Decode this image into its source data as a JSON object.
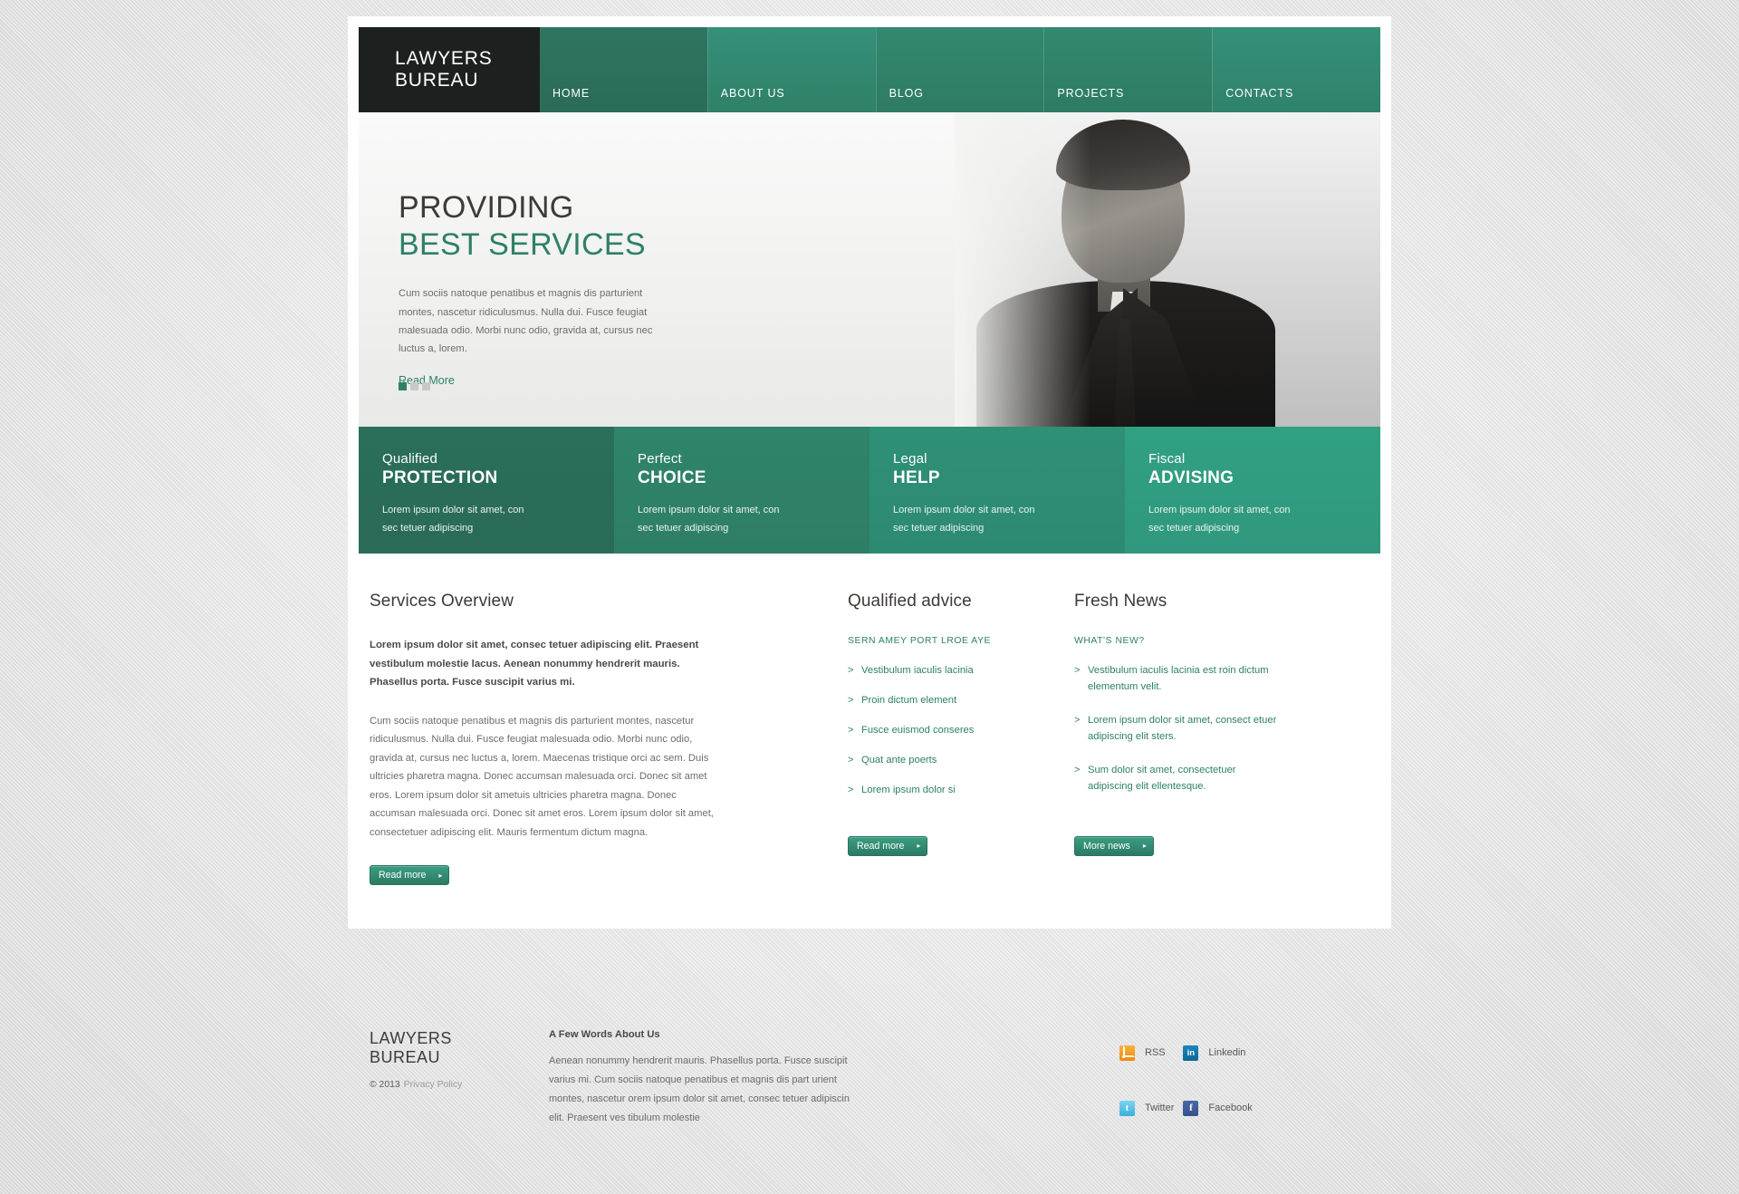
{
  "site": {
    "logo_line1": "LAWYERS",
    "logo_line2": "BUREAU"
  },
  "nav": {
    "items": [
      {
        "label": "HOME"
      },
      {
        "label": "ABOUT US"
      },
      {
        "label": "BLOG"
      },
      {
        "label": "PROJECTS"
      },
      {
        "label": "CONTACTS"
      }
    ]
  },
  "hero": {
    "title_line1": "PROVIDING",
    "title_line2": "BEST SERVICES",
    "paragraph": "Cum sociis natoque penatibus et magnis dis parturient montes, nascetur ridiculusmus. Nulla dui. Fusce feugiat malesuada odio. Morbi nunc odio, gravida at, cursus nec luctus a, lorem.",
    "read_more": "Read More",
    "slides": 3,
    "active_slide": 1
  },
  "features": [
    {
      "sub": "Qualified",
      "title": "PROTECTION",
      "text": "Lorem ipsum dolor sit amet, con sec tetuer adipiscing",
      "color": "#2a6e5b"
    },
    {
      "sub": "Perfect",
      "title": "CHOICE",
      "text": "Lorem ipsum dolor sit amet, con sec tetuer adipiscing",
      "color": "#2f8469"
    },
    {
      "sub": "Legal",
      "title": "HELP",
      "text": "Lorem ipsum dolor sit amet, con sec tetuer adipiscing",
      "color": "#2e9077"
    },
    {
      "sub": "Fiscal",
      "title": "ADVISING",
      "text": "Lorem ipsum dolor sit amet, con sec tetuer adipiscing",
      "color": "#31a083"
    }
  ],
  "services": {
    "heading": "Services Overview",
    "lead": "Lorem ipsum dolor sit amet, consec tetuer adipiscing elit. Praesent vestibulum molestie lacus. Aenean nonummy hendrerit mauris. Phasellus porta. Fusce suscipit varius mi.",
    "body": "Cum sociis natoque penatibus et magnis dis parturient montes, nascetur ridiculusmus. Nulla dui. Fusce feugiat malesuada odio. Morbi nunc odio, gravida at, cursus nec luctus a, lorem. Maecenas tristique orci ac sem. Duis ultricies pharetra magna. Donec accumsan malesuada orci. Donec sit amet eros. Lorem ipsum dolor sit ametuis ultricies pharetra magna. Donec accumsan malesuada orci. Donec sit amet eros. Lorem ipsum dolor sit amet, consectetuer adipiscing elit. Mauris fermentum dictum magna.",
    "button": "Read more"
  },
  "advice": {
    "heading": "Qualified advice",
    "sub_label": "SERN AMEY PORT LROE AYE",
    "items": [
      {
        "text": "Vestibulum iaculis lacinia"
      },
      {
        "text": "Proin dictum element"
      },
      {
        "text": "Fusce euismod conseres"
      },
      {
        "text": "Quat ante poerts"
      },
      {
        "text": "Lorem ipsum dolor si"
      }
    ],
    "button": "Read more"
  },
  "news": {
    "heading": "Fresh News",
    "sub_label": "WHAT'S NEW?",
    "items": [
      {
        "text": "Vestibulum iaculis lacinia est roin dictum elementum velit."
      },
      {
        "text": "Lorem ipsum dolor sit amet, consect etuer adipiscing elit sters."
      },
      {
        "text": "Sum dolor sit amet, consectetuer adipiscing elit ellentesque."
      }
    ],
    "button": "More news"
  },
  "footer": {
    "logo_line1": "LAWYERS",
    "logo_line2": "BUREAU",
    "copyright": "© 2013",
    "privacy": "Privacy Policy",
    "about_heading": "A Few Words About Us",
    "about_text": "Aenean nonummy hendrerit mauris. Phasellus porta. Fusce suscipit varius mi. Cum sociis natoque penatibus et magnis dis part urient montes, nascetur orem ipsum dolor sit amet, consec tetuer adipiscin elit. Praesent ves tibulum molestie",
    "social": [
      {
        "label": "RSS",
        "icon": "rss-icon",
        "glyph": ""
      },
      {
        "label": "Linkedin",
        "icon": "linkedin-icon",
        "glyph": "in"
      },
      {
        "label": "Twitter",
        "icon": "twitter-icon",
        "glyph": "t"
      },
      {
        "label": "Facebook",
        "icon": "facebook-icon",
        "glyph": "f"
      }
    ]
  },
  "theme": {
    "accent": "#2e8068",
    "dark": "#1c211f",
    "text": "#6d6d6d"
  }
}
